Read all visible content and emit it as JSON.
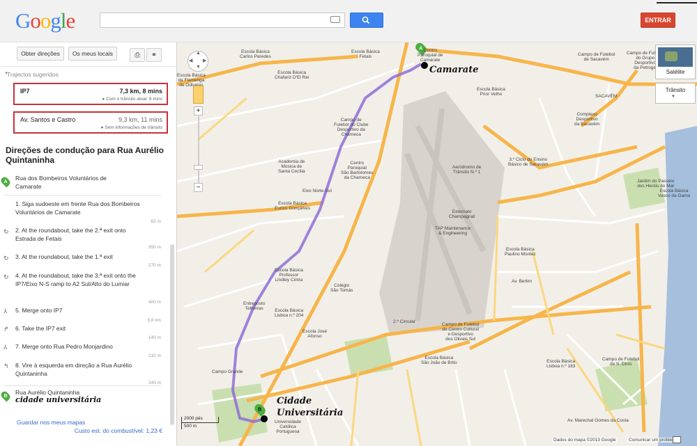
{
  "header": {
    "logo": "Google",
    "search_value": "",
    "signin_label": "ENTRAR"
  },
  "sidebar": {
    "get_directions": "Obter direções",
    "my_places": "Os meus locais",
    "suggested_routes_label": "Trajectos sugeridos",
    "routes": [
      {
        "name": "IP7",
        "distance": "7,3 km, 8 mins",
        "note": "Com o trânsito atual: 8 mins"
      },
      {
        "name": "Av. Santos e Castro",
        "distance": "9,3 km, 11 mins",
        "note": "Sem informações de trânsito"
      }
    ],
    "directions_title": "Direções de condução para Rua Aurélio Quintaninha",
    "start": {
      "marker": "A",
      "address": "Rua dos Bombeiros Voluntários de Camarate"
    },
    "steps": [
      {
        "text": "1. Siga sudoeste em frente Rua dos Bombeiros Voluntários de Camarate",
        "distance": "62 m"
      },
      {
        "text": "2. At the roundabout, take the 2.ª exit onto Estrada de Fetais",
        "distance": "350 m"
      },
      {
        "text": "3. At the roundabout, take the 1.ª exit",
        "distance": "270 m"
      },
      {
        "text": "4. At the roundabout, take the 3.ª exit onto the IP7/Eixo N-S ramp to A2 Sul/Alto do Lumiar",
        "distance": "400 m"
      },
      {
        "text": "5. Merge onto IP7",
        "distance": "5,8 km"
      },
      {
        "text": "6. Take the IP7 exit",
        "distance": "140 m"
      },
      {
        "text": "7. Merge onto Rua Pedro Monjardino",
        "distance": "210 m"
      },
      {
        "text": "8. Vire à esquerda em direção a Rua Aurélio Quintaninha",
        "distance": "240 m"
      }
    ],
    "end": {
      "marker": "B",
      "address": "Rua Aurélio Quintaninha"
    },
    "end_handwritten": "cidade universitária",
    "save_link": "Guardar nos meus mapas",
    "fuel_label": "Custo est. do combustível:",
    "fuel_value": "1,23 €"
  },
  "map": {
    "satellite_label": "Satélite",
    "traffic_label": "Trânsito",
    "scale_top": "2000 pés",
    "scale_bottom": "500 m",
    "attribution": "Dados do mapa ©2013 Google",
    "report": "Comunicar um problema",
    "annotation_start": "Camarate",
    "annotation_end_line1": "Cidade",
    "annotation_end_line2": "Universitária",
    "marker_a": "A",
    "marker_b": "B",
    "colors": {
      "route": "#8e6fd6",
      "highway": "#f7b54a",
      "water": "#a5bfdd",
      "park": "#c9dfaf",
      "airport": "#d8d4cd"
    },
    "labels": {
      "l1": "Escola Básica\nCarlos Paredes",
      "l2": "Escola Básica\nChafariz D'El Rei",
      "l3": "Escola Básica\nFetais",
      "l4": "Centro\nParoquial de\nCamarate",
      "l5": "Campo de\nFutebol do Clube\nDesportivo da\nCharneca",
      "l6": "Academia de\nMúsica de\nSanta Cecília",
      "l7": "Centro\nParoquial\nSão Bartolomeu\nda Charneca",
      "l8": "Escola Básica\nEurico Gonçalves",
      "l9": "Aeródromo de\nTrânsito N.º 1",
      "l10": "Externato\nChampagnat",
      "l11": "TAP Maintenance\n& Engineering",
      "l12": "Escola Básica\nPaulino Montez",
      "l13": "Escola Básica\nProfessor\nLindley Cintra",
      "l14": "Colégio\nSão Tomás",
      "l15": "Entreposto\nTelheiras",
      "l16": "Escola Básica\nLisboa n.º 204",
      "l17": "Escola José\nAfonso",
      "l18": "Campo de Futebol\ndo Centro Cultural\ne Desportivo\ndos Olivais Sul",
      "l19": "Escola Básica\nLisboa n.º 183",
      "l20": "Campo de Futebol\nde Sacavém",
      "l21": "Escola Básica\nPrior Velho",
      "l22": "Complexo\nDesportivo\nda Sacavém",
      "l23": "3.º Ciclo do Ensino\nBásico de Sacavém",
      "l24": "Escola Básica\nVasco da Gama",
      "l25": "Jardim do Passeio\ndos Heróis do Mar",
      "l26": "Universidade\nCatólica\nPortuguesa",
      "l27": "Campo de Futebol\ndo Grupo\nDesportivo\nda Petrogal",
      "l28": "Escola Básica\nda Flamenga\nde Odivelas",
      "l29": "Campo de Futebol\nde S. Dinis",
      "l30": "Campo Grande",
      "l31": "Av. Berlim",
      "l32": "2.ª Circular",
      "l33": "SACAVÉM",
      "l34": "Escola Básica\nSão João de Brito",
      "l35": "Av. Marechal Gomes da Costa",
      "l36": "Eixo Norte-Sul"
    }
  }
}
